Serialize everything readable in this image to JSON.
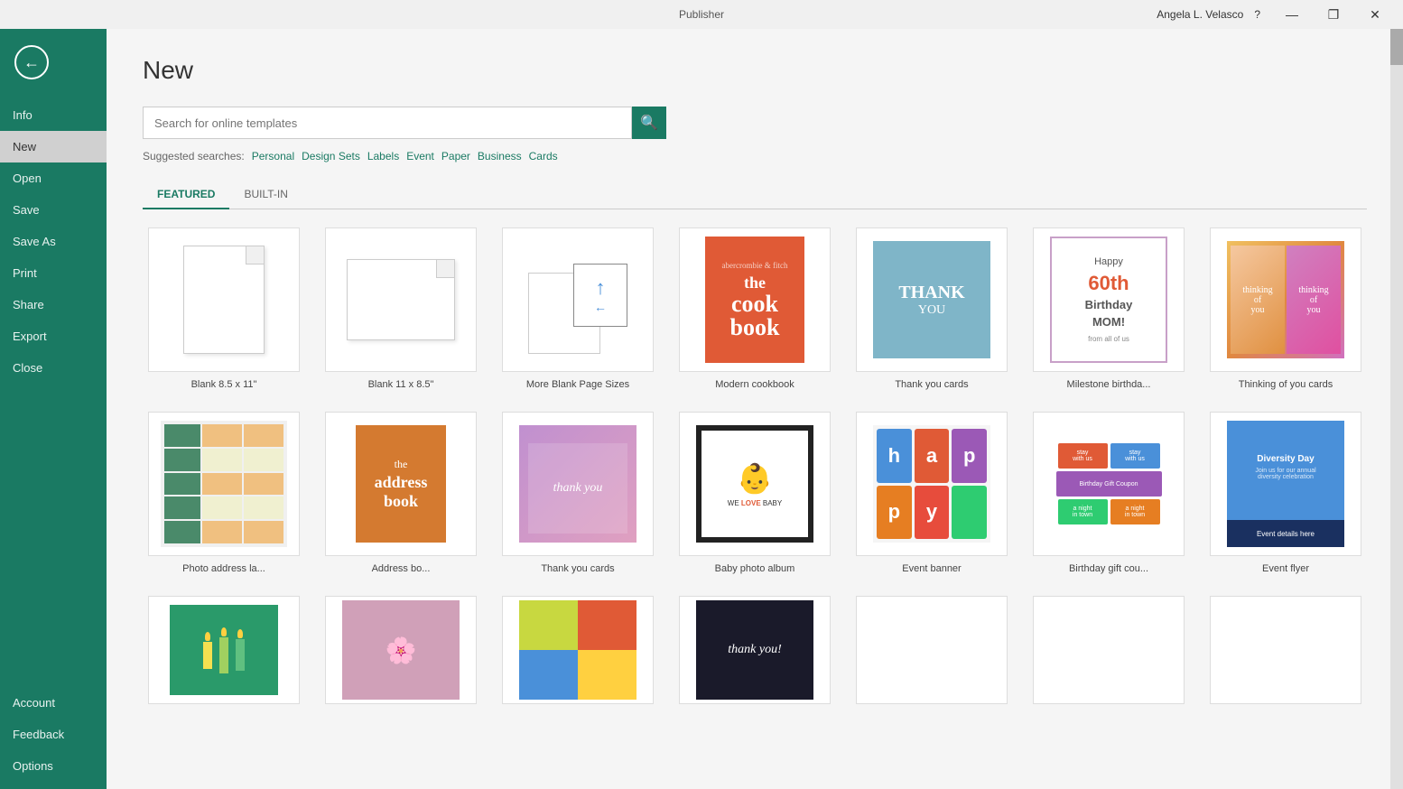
{
  "titlebar": {
    "app_name": "Publisher",
    "user_name": "Angela L. Velasco",
    "help": "?",
    "minimize": "—",
    "restore": "❐",
    "close": "✕"
  },
  "sidebar": {
    "back_tooltip": "Back",
    "items": [
      {
        "id": "info",
        "label": "Info"
      },
      {
        "id": "new",
        "label": "New",
        "active": true
      },
      {
        "id": "open",
        "label": "Open"
      },
      {
        "id": "save",
        "label": "Save"
      },
      {
        "id": "saveas",
        "label": "Save As"
      },
      {
        "id": "print",
        "label": "Print"
      },
      {
        "id": "share",
        "label": "Share"
      },
      {
        "id": "export",
        "label": "Export"
      },
      {
        "id": "close",
        "label": "Close"
      }
    ],
    "bottom_items": [
      {
        "id": "account",
        "label": "Account"
      },
      {
        "id": "feedback",
        "label": "Feedback"
      },
      {
        "id": "options",
        "label": "Options"
      }
    ]
  },
  "main": {
    "title": "New",
    "search": {
      "placeholder": "Search for online templates",
      "button_label": "🔍"
    },
    "suggested": {
      "label": "Suggested searches:",
      "items": [
        "Personal",
        "Design Sets",
        "Labels",
        "Event",
        "Paper",
        "Business",
        "Cards"
      ]
    },
    "tabs": [
      {
        "id": "featured",
        "label": "FEATURED",
        "active": true
      },
      {
        "id": "builtin",
        "label": "BUILT-IN"
      }
    ],
    "templates_row1": [
      {
        "id": "blank-85x11",
        "label": "Blank 8.5 x 11\"",
        "type": "blank-portrait"
      },
      {
        "id": "blank-11x85",
        "label": "Blank 11 x 8.5\"",
        "type": "blank-landscape"
      },
      {
        "id": "more-blank",
        "label": "More Blank Page Sizes",
        "type": "more-blank"
      },
      {
        "id": "modern-cookbook",
        "label": "Modern cookbook",
        "type": "cookbook"
      },
      {
        "id": "thank-you-cards",
        "label": "Thank you cards",
        "type": "thankyou"
      },
      {
        "id": "milestone-birthday",
        "label": "Milestone birthda...",
        "type": "milestone"
      },
      {
        "id": "thinking-of-you",
        "label": "Thinking of you cards",
        "type": "thinking"
      }
    ],
    "templates_row2": [
      {
        "id": "photo-address",
        "label": "Photo address la...",
        "type": "photo-addr"
      },
      {
        "id": "address-book",
        "label": "Address bo...",
        "type": "addrbook"
      },
      {
        "id": "thank-you-cards-2",
        "label": "Thank you cards",
        "type": "thankyou2"
      },
      {
        "id": "baby-photo",
        "label": "Baby photo album",
        "type": "baby"
      },
      {
        "id": "event-banner",
        "label": "Event banner",
        "type": "event-banner"
      },
      {
        "id": "birthday-gift",
        "label": "Birthday gift cou...",
        "type": "gift"
      },
      {
        "id": "event-flyer",
        "label": "Event flyer",
        "type": "diversity"
      }
    ],
    "templates_row3": [
      {
        "id": "candles",
        "label": "",
        "type": "candles"
      },
      {
        "id": "photo-collage",
        "label": "",
        "type": "photo-collage"
      },
      {
        "id": "colorful",
        "label": "",
        "type": "colorful"
      },
      {
        "id": "dark-ty",
        "label": "",
        "type": "dark-thankyou"
      },
      {
        "id": "blank5",
        "label": "",
        "type": "white-blank"
      },
      {
        "id": "blank6",
        "label": "",
        "type": "white-blank"
      },
      {
        "id": "blank7",
        "label": "",
        "type": "white-blank"
      }
    ]
  },
  "colors": {
    "sidebar_bg": "#1a7a63",
    "accent": "#1a7a63",
    "tab_active": "#1a7a63"
  }
}
